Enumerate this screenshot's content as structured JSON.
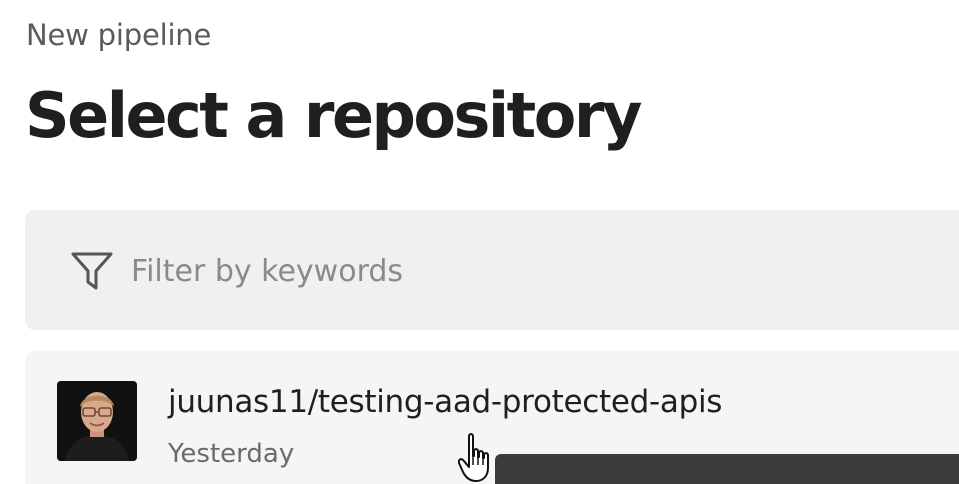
{
  "header": {
    "breadcrumb": "New pipeline",
    "title": "Select a repository"
  },
  "filter": {
    "icon": "filter-icon",
    "placeholder": "Filter by keywords",
    "value": ""
  },
  "repositories": [
    {
      "name": "juunas11/testing-aad-protected-apis",
      "updated": "Yesterday",
      "avatar": "user-avatar"
    }
  ],
  "colors": {
    "filter_background": "#f0f0f0",
    "row_background": "#f5f5f5",
    "tooltip_background": "#3b3b3b",
    "title_text": "#1f1f1f"
  }
}
